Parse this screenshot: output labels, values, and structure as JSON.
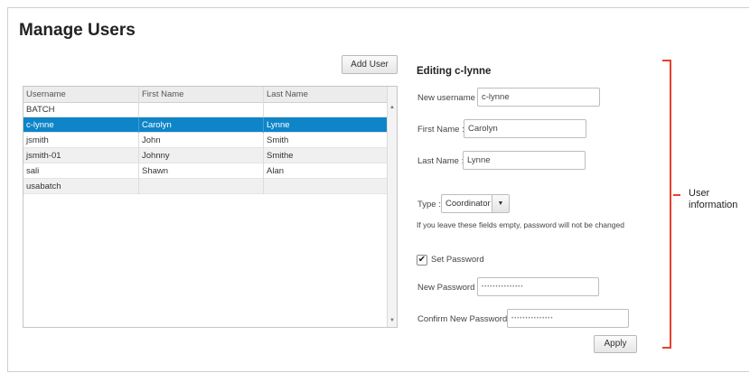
{
  "page": {
    "title": "Manage Users"
  },
  "toolbar": {
    "add_user_label": "Add User"
  },
  "table": {
    "headers": [
      "Username",
      "First Name",
      "Last Name"
    ],
    "rows": [
      [
        "BATCH",
        "",
        ""
      ],
      [
        "c-lynne",
        "Carolyn",
        "Lynne"
      ],
      [
        "jsmith",
        "John",
        "Smith"
      ],
      [
        "jsmith-01",
        "Johnny",
        "Smithe"
      ],
      [
        "sali",
        "Shawn",
        "Alan"
      ],
      [
        "usabatch",
        "",
        ""
      ]
    ],
    "selected_username": "c-lynne"
  },
  "editor": {
    "heading": "Editing c-lynne",
    "username_label": "New username :",
    "username_value": "c-lynne",
    "first_name_label": "First Name :",
    "first_name_value": "Carolyn",
    "last_name_label": "Last Name :",
    "last_name_value": "Lynne",
    "type_label": "Type :",
    "type_value": "Coordinator",
    "hint": "If you leave these fields empty, password will not be changed",
    "set_password_label": "Set Password",
    "set_password_checked": true,
    "new_password_label": "New Password :",
    "new_password_value": "•••••••••••••••",
    "confirm_password_label": "Confirm New Password :",
    "confirm_password_value": "•••••••••••••••",
    "apply_label": "Apply"
  },
  "annotation": {
    "line1": "User",
    "line2": "information",
    "color": "#e8402e"
  },
  "colors": {
    "selected_row": "#0f85c9"
  },
  "icons": {
    "checkbox": "checkmark-icon",
    "dropdown": "caret-down-icon",
    "scroll_up": "arrow-up-icon",
    "scroll_down": "arrow-down-icon"
  }
}
